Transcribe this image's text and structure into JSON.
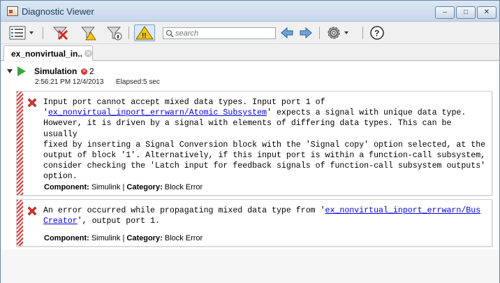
{
  "window": {
    "title": "Diagnostic Viewer"
  },
  "toolbar": {
    "search_placeholder": "search",
    "items": [
      "view-menu",
      "clear-all",
      "filter",
      "filter-info",
      "warnings-toggle",
      "back",
      "forward",
      "settings",
      "help"
    ]
  },
  "tab": {
    "label": "ex_nonvirtual_in..​"
  },
  "simulation": {
    "label": "Simulation",
    "error_count": "2",
    "time": "2:56:21 PM 12/4/2013",
    "elapsed": "Elapsed:5 sec"
  },
  "messages": [
    {
      "line1": "Input port cannot accept mixed data types. Input port 1 of",
      "link": "ex_nonvirtual_inport_errwarn/Atomic Subsystem",
      "line2_pre": "'",
      "line2_post": "' expects a signal with unique data type.",
      "line3": "However, it is driven by a signal with elements of differing data types. This can be usually",
      "line4": "fixed by inserting a Signal Conversion block with the 'Signal copy' option selected, at the",
      "line5": "output of block '1'. Alternatively, if this input port is within a function-call subsystem,",
      "line6": "consider checking the 'Latch input for feedback signals of function-call subsystem outputs'",
      "line7": "option.",
      "component_label": "Component:",
      "component": "Simulink",
      "sep": "|",
      "category_label": "Category:",
      "category": "Block Error"
    },
    {
      "line1_pre": "An error occurred while propagating mixed data type from '",
      "link1": "ex_nonvirtual_inport_errwarn/Bus",
      "link2": "Creator",
      "line2_post": "', output port 1.",
      "component_label": "Component:",
      "component": "Simulink",
      "sep": "|",
      "category_label": "Category:",
      "category": "Block Error"
    }
  ],
  "colors": {
    "error": "#e0302a",
    "link": "#0000ee",
    "play": "#3aa63a"
  }
}
